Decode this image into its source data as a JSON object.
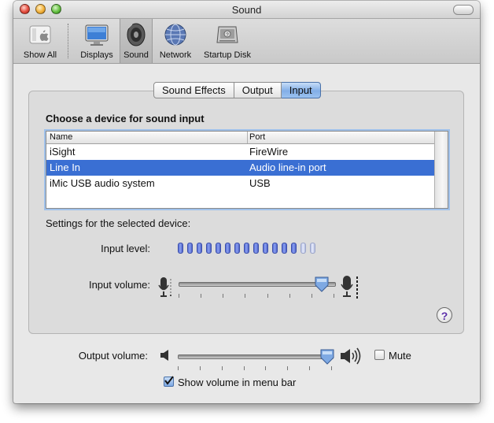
{
  "window": {
    "title": "Sound"
  },
  "toolbar": {
    "items": [
      {
        "label": "Show All",
        "icon": "apple-icon"
      },
      {
        "label": "Displays",
        "icon": "display-icon"
      },
      {
        "label": "Sound",
        "icon": "speaker-icon",
        "selected": true
      },
      {
        "label": "Network",
        "icon": "globe-icon"
      },
      {
        "label": "Startup Disk",
        "icon": "hard-disk-icon"
      }
    ]
  },
  "tabs": [
    {
      "label": "Sound Effects",
      "active": false
    },
    {
      "label": "Output",
      "active": false
    },
    {
      "label": "Input",
      "active": true
    }
  ],
  "input_panel": {
    "heading": "Choose a device for sound input",
    "columns": [
      "Name",
      "Port"
    ],
    "devices": [
      {
        "name": "iSight",
        "port": "FireWire",
        "selected": false
      },
      {
        "name": "Line In",
        "port": "Audio line-in port",
        "selected": true
      },
      {
        "name": "iMic USB audio system",
        "port": "USB",
        "selected": false
      }
    ],
    "settings_label": "Settings for the selected device:",
    "input_level_label": "Input level:",
    "input_level": {
      "segments": 15,
      "lit": 13
    },
    "input_volume_label": "Input volume:",
    "input_volume": 0.92,
    "help_label": "?"
  },
  "output": {
    "output_volume_label": "Output volume:",
    "output_volume": 0.97,
    "mute_label": "Mute",
    "mute": false,
    "show_volume_label": "Show volume in menu bar",
    "show_volume": true
  },
  "colors": {
    "selection": "#3a6fd3",
    "active_tab": "#82aee7",
    "level_on": "#5a6fd8",
    "level_off": "#c8cfec"
  }
}
